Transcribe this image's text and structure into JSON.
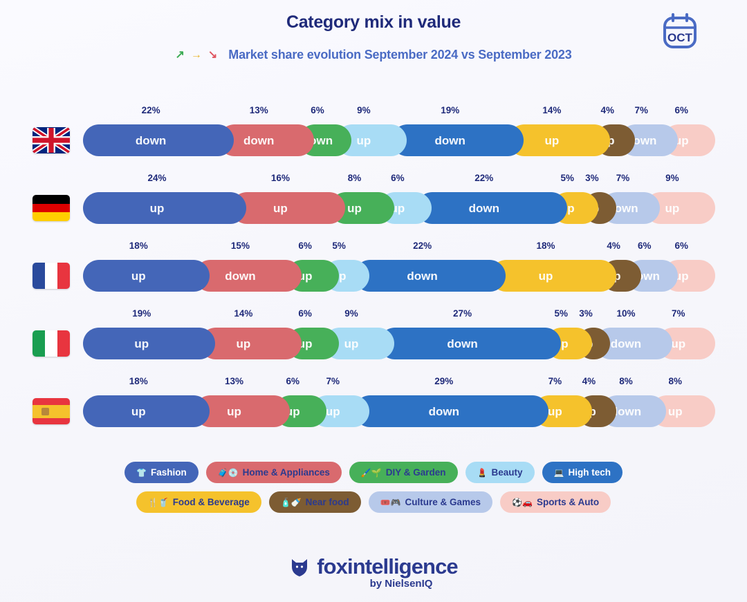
{
  "header": {
    "title": "Category mix in value",
    "subtitle": "Market share evolution September 2024 vs September 2023",
    "trend_up_icon": "↗",
    "trend_flat_icon": "→",
    "trend_down_icon": "↘",
    "calendar_month": "OCT",
    "calendar_icon": "calendar-icon"
  },
  "categories": [
    {
      "key": "fashion",
      "label": "Fashion",
      "color": "#4466b8",
      "text_color": "#ffffff",
      "icon": "👕"
    },
    {
      "key": "home",
      "label": "Home & Appliances",
      "color": "#d96a6e",
      "text_color": "#2b3a8f",
      "icon": "🧳💿"
    },
    {
      "key": "diy",
      "label": "DIY & Garden",
      "color": "#47b059",
      "text_color": "#2b3a8f",
      "icon": "🖌️🌱"
    },
    {
      "key": "beauty",
      "label": "Beauty",
      "color": "#a8dcf5",
      "text_color": "#2b3a8f",
      "icon": "💄"
    },
    {
      "key": "hightech",
      "label": "High tech",
      "color": "#2d72c4",
      "text_color": "#ffffff",
      "icon": "💻"
    },
    {
      "key": "food",
      "label": "Food & Beverage",
      "color": "#f5c22c",
      "text_color": "#2b3a8f",
      "icon": "🍴🥤"
    },
    {
      "key": "nearfood",
      "label": "Near food",
      "color": "#7d5c33",
      "text_color": "#2b3a8f",
      "icon": "🧴🍼"
    },
    {
      "key": "culture",
      "label": "Culture & Games",
      "color": "#b7c9ea",
      "text_color": "#2b3a8f",
      "icon": "🎟️🎮"
    },
    {
      "key": "sports",
      "label": "Sports & Auto",
      "color": "#f8ccc6",
      "text_color": "#2b3a8f",
      "icon": "⚽🚗"
    }
  ],
  "chart_data": {
    "type": "bar",
    "orientation": "horizontal",
    "stacked": true,
    "title": "Category mix in value",
    "subtitle": "Market share evolution September 2024 vs September 2023",
    "unit": "%",
    "categories": [
      "Fashion",
      "Home & Appliances",
      "DIY & Garden",
      "Beauty",
      "High tech",
      "Food & Beverage",
      "Near food",
      "Culture & Games",
      "Sports & Auto"
    ],
    "countries": [
      "United Kingdom",
      "Germany",
      "France",
      "Italy",
      "Spain"
    ],
    "series": [
      {
        "name": "United Kingdom",
        "flag": "uk-flag",
        "values": [
          22,
          13,
          6,
          9,
          19,
          14,
          4,
          7,
          6
        ],
        "labels": [
          "22%",
          "13%",
          "6%",
          "9%",
          "19%",
          "14%",
          "4%",
          "7%",
          "6%"
        ],
        "trends": [
          "down",
          "down",
          "down",
          "up",
          "down",
          "up",
          "up",
          "down",
          "up"
        ]
      },
      {
        "name": "Germany",
        "flag": "germany-flag",
        "values": [
          24,
          16,
          8,
          6,
          22,
          5,
          3,
          7,
          9
        ],
        "labels": [
          "24%",
          "16%",
          "8%",
          "6%",
          "22%",
          "5%",
          "3%",
          "7%",
          "9%"
        ],
        "trends": [
          "up",
          "up",
          "up",
          "up",
          "down",
          "up",
          "up",
          "down",
          "up"
        ]
      },
      {
        "name": "France",
        "flag": "france-flag",
        "values": [
          18,
          15,
          6,
          5,
          22,
          18,
          4,
          6,
          6
        ],
        "labels": [
          "18%",
          "15%",
          "6%",
          "5%",
          "22%",
          "18%",
          "4%",
          "6%",
          "6%"
        ],
        "trends": [
          "up",
          "down",
          "up",
          "up",
          "down",
          "up",
          "up",
          "down",
          "up"
        ]
      },
      {
        "name": "Italy",
        "flag": "italy-flag",
        "values": [
          19,
          14,
          6,
          9,
          27,
          5,
          3,
          10,
          7
        ],
        "labels": [
          "19%",
          "14%",
          "6%",
          "9%",
          "27%",
          "5%",
          "3%",
          "10%",
          "7%"
        ],
        "trends": [
          "up",
          "up",
          "up",
          "up",
          "down",
          "up",
          "up",
          "down",
          "up"
        ]
      },
      {
        "name": "Spain",
        "flag": "spain-flag",
        "values": [
          18,
          13,
          6,
          7,
          29,
          7,
          4,
          8,
          8
        ],
        "labels": [
          "18%",
          "13%",
          "6%",
          "7%",
          "29%",
          "7%",
          "4%",
          "8%",
          "8%"
        ],
        "trends": [
          "up",
          "up",
          "up",
          "up",
          "down",
          "up",
          "up",
          "down",
          "up"
        ]
      }
    ],
    "legend_position": "bottom",
    "grid": false
  },
  "footer": {
    "brand": "foxintelligence",
    "byline": "by NielsenIQ",
    "logo_icon": "fox-shield-logo"
  },
  "colors": {
    "background": "#f7f7fb",
    "title": "#1f2a7a",
    "subtitle": "#4a6bc4",
    "brand": "#2b3a8f"
  }
}
